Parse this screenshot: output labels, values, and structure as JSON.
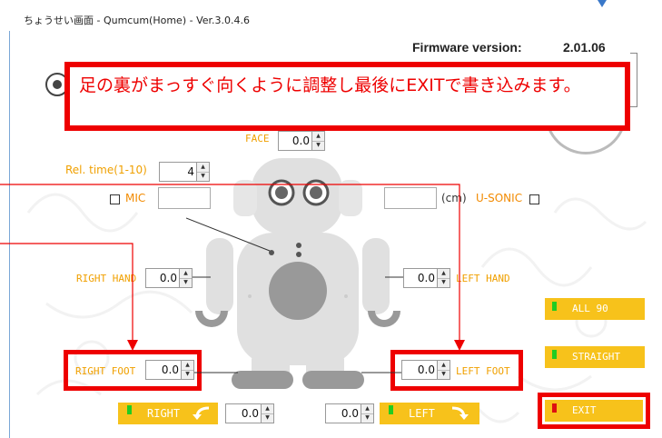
{
  "window": {
    "title": "ちょうせい画面 - Qumcum(Home) - Ver.3.0.4.6"
  },
  "firmware": {
    "label": "Firmware version:",
    "value": "2.01.06"
  },
  "callout": {
    "text": "足の裏がまっすぐ向くように調整し最後にEXITで書き込みます。"
  },
  "face": {
    "label": "FACE",
    "value": "0.0"
  },
  "rel_time": {
    "label": "Rel. time(1-10)",
    "value": "4"
  },
  "mic": {
    "label": "MIC",
    "value": ""
  },
  "usonic": {
    "unit": "(cm)",
    "label": "U-SONIC",
    "value": ""
  },
  "right_hand": {
    "label": "RIGHT HAND",
    "value": "0.0"
  },
  "left_hand": {
    "label": "LEFT HAND",
    "value": "0.0"
  },
  "right_foot": {
    "label": "RIGHT FOOT",
    "value": "0.0"
  },
  "left_foot": {
    "label": "LEFT FOOT",
    "value": "0.0"
  },
  "turn": {
    "right_label": "RIGHT",
    "right_value": "0.0",
    "left_label": "LEFT",
    "left_value": "0.0"
  },
  "side_buttons": {
    "all90": "ALL 90",
    "straight": "STRAIGHT",
    "exit": "EXIT"
  },
  "colors": {
    "accent_yellow": "#f7c21b",
    "label_orange": "#f0a000",
    "annotation_red": "#ee0000",
    "led_green": "#22cc22",
    "led_red": "#dd1111"
  },
  "icons": {
    "right_turn": "curved-arrow-left-icon",
    "left_turn": "curved-arrow-right-icon"
  }
}
